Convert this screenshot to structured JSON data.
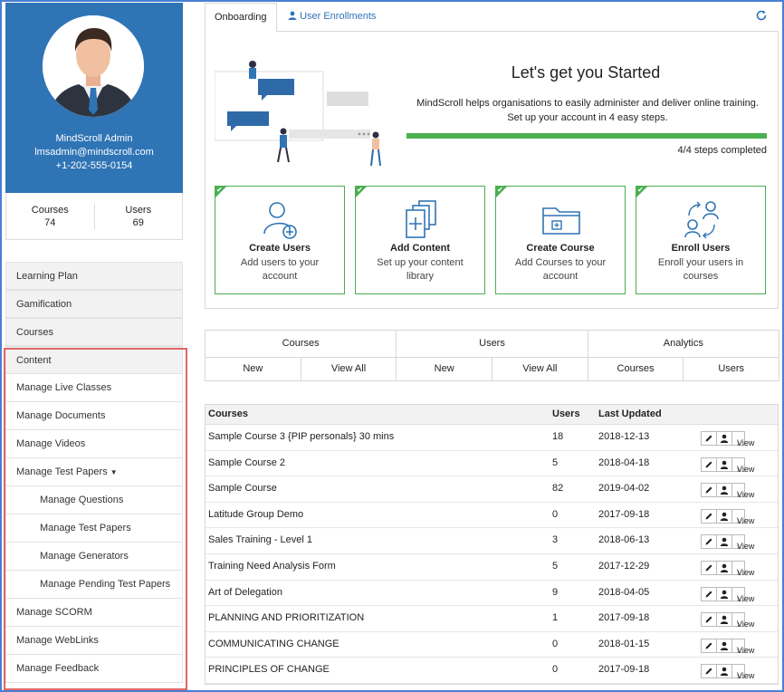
{
  "user": {
    "name": "MindScroll Admin",
    "email": "lmsadmin@mindscroll.com",
    "phone": "+1-202-555-0154"
  },
  "stats": {
    "courses_label": "Courses",
    "courses_value": "74",
    "users_label": "Users",
    "users_value": "69"
  },
  "nav": {
    "learning_plan": "Learning Plan",
    "gamification": "Gamification",
    "courses": "Courses",
    "content": "Content",
    "items": [
      "Manage Live Classes",
      "Manage Documents",
      "Manage Videos",
      "Manage Test Papers"
    ],
    "sub_items": [
      "Manage Questions",
      "Manage Test Papers",
      "Manage Generators",
      "Manage Pending Test Papers"
    ],
    "bottom_items": [
      "Manage SCORM",
      "Manage WebLinks",
      "Manage Feedback"
    ]
  },
  "tabs": {
    "onboarding": "Onboarding",
    "user_enrollments": "User Enrollments"
  },
  "hero": {
    "title": "Let's get you Started",
    "desc1": "MindScroll helps organisations to easily administer and deliver online training.",
    "desc2": "Set up your account in 4 easy steps.",
    "progress_fraction": 1.0,
    "progress_text": "4/4 steps completed"
  },
  "cards": [
    {
      "title": "Create Users",
      "desc": "Add users to your account"
    },
    {
      "title": "Add Content",
      "desc": "Set up your content library"
    },
    {
      "title": "Create Course",
      "desc": "Add Courses to your account"
    },
    {
      "title": "Enroll Users",
      "desc": "Enroll your users in courses"
    }
  ],
  "grid": {
    "heads": [
      "Courses",
      "Users",
      "Analytics"
    ],
    "subs": [
      "New",
      "View All",
      "New",
      "View All",
      "Courses",
      "Users"
    ]
  },
  "table": {
    "headers": [
      "Courses",
      "Users",
      "Last Updated"
    ],
    "view_label": "View",
    "rows": [
      [
        "Sample Course 3 {PIP personals} 30 mins",
        "18",
        "2018-12-13"
      ],
      [
        "Sample Course 2",
        "5",
        "2018-04-18"
      ],
      [
        "Sample Course",
        "82",
        "2019-04-02"
      ],
      [
        "Latitude Group Demo",
        "0",
        "2017-09-18"
      ],
      [
        "Sales Training - Level 1",
        "3",
        "2018-06-13"
      ],
      [
        "Training Need Analysis Form",
        "5",
        "2017-12-29"
      ],
      [
        "Art of Delegation",
        "9",
        "2018-04-05"
      ],
      [
        "PLANNING AND PRIORITIZATION",
        "1",
        "2017-09-18"
      ],
      [
        "COMMUNICATING CHANGE",
        "0",
        "2018-01-15"
      ],
      [
        "PRINCIPLES OF CHANGE",
        "0",
        "2017-09-18"
      ]
    ]
  },
  "colors": {
    "brand": "#2f74b5",
    "success": "#4caf50",
    "highlight": "#e06666"
  }
}
